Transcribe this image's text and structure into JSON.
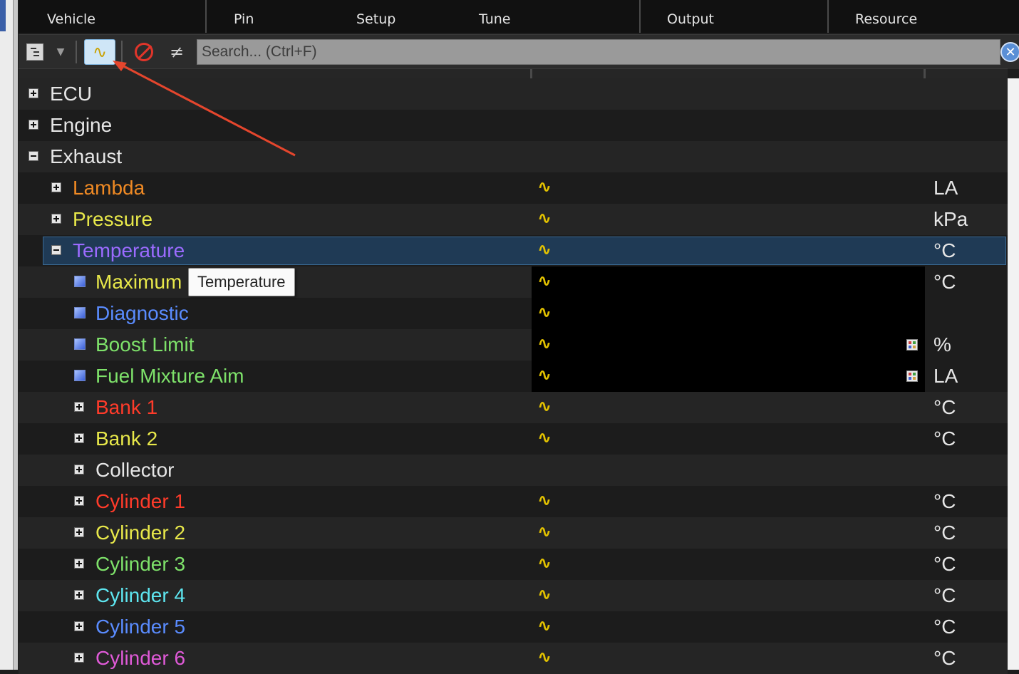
{
  "tabs": [
    "Vehicle",
    "Pin",
    "Setup",
    "Tune",
    "Output",
    "Resource"
  ],
  "toolbar": {
    "search_placeholder": "Search... (Ctrl+F)",
    "wave_glyph": "∿",
    "not_equal_glyph": "≠",
    "clear_glyph": "✕"
  },
  "tree": {
    "rows": [
      {
        "label": "ECU",
        "color": "#e6e6e6",
        "expander": "plus",
        "level": 0,
        "wave": false,
        "unit": "",
        "table_icon": false
      },
      {
        "label": "Engine",
        "color": "#e6e6e6",
        "expander": "plus",
        "level": 0,
        "wave": false,
        "unit": "",
        "table_icon": false
      },
      {
        "label": "Exhaust",
        "color": "#e6e6e6",
        "expander": "minus",
        "level": 0,
        "wave": false,
        "unit": "",
        "table_icon": false
      },
      {
        "label": "Lambda",
        "color": "#f08a24",
        "expander": "plus",
        "level": 1,
        "wave": true,
        "unit": "LA",
        "table_icon": false
      },
      {
        "label": "Pressure",
        "color": "#e8e84a",
        "expander": "plus",
        "level": 1,
        "wave": true,
        "unit": "kPa",
        "table_icon": false
      },
      {
        "label": "Temperature",
        "color": "#9b6bff",
        "expander": "minus",
        "level": 1,
        "wave": true,
        "unit": "°C",
        "table_icon": false,
        "selected": true
      },
      {
        "label": "Maximum",
        "color": "#e8e84a",
        "expander": "leaf",
        "level": 2,
        "wave": true,
        "unit": "°C",
        "table_icon": false
      },
      {
        "label": "Diagnostic",
        "color": "#5a8cff",
        "expander": "leaf",
        "level": 2,
        "wave": true,
        "unit": "",
        "table_icon": false
      },
      {
        "label": "Boost Limit",
        "color": "#7ee26a",
        "expander": "leaf",
        "level": 2,
        "wave": true,
        "unit": "%",
        "table_icon": true
      },
      {
        "label": "Fuel Mixture Aim",
        "color": "#7ee26a",
        "expander": "leaf",
        "level": 2,
        "wave": true,
        "unit": "LA",
        "table_icon": true
      },
      {
        "label": "Bank 1",
        "color": "#ff3b2a",
        "expander": "plus",
        "level": 2,
        "wave": true,
        "unit": "°C",
        "table_icon": false
      },
      {
        "label": "Bank 2",
        "color": "#e8e84a",
        "expander": "plus",
        "level": 2,
        "wave": true,
        "unit": "°C",
        "table_icon": false
      },
      {
        "label": "Collector",
        "color": "#e6e6e6",
        "expander": "plus",
        "level": 2,
        "wave": false,
        "unit": "",
        "table_icon": false
      },
      {
        "label": "Cylinder 1",
        "color": "#ff3b2a",
        "expander": "plus",
        "level": 2,
        "wave": true,
        "unit": "°C",
        "table_icon": false
      },
      {
        "label": "Cylinder 2",
        "color": "#e8e84a",
        "expander": "plus",
        "level": 2,
        "wave": true,
        "unit": "°C",
        "table_icon": false
      },
      {
        "label": "Cylinder 3",
        "color": "#7ee26a",
        "expander": "plus",
        "level": 2,
        "wave": true,
        "unit": "°C",
        "table_icon": false
      },
      {
        "label": "Cylinder 4",
        "color": "#5ee6f0",
        "expander": "plus",
        "level": 2,
        "wave": true,
        "unit": "°C",
        "table_icon": false
      },
      {
        "label": "Cylinder 5",
        "color": "#5a8cff",
        "expander": "plus",
        "level": 2,
        "wave": true,
        "unit": "°C",
        "table_icon": false
      },
      {
        "label": "Cylinder 6",
        "color": "#e05ad8",
        "expander": "plus",
        "level": 2,
        "wave": true,
        "unit": "°C",
        "table_icon": false
      }
    ]
  },
  "tooltip": {
    "text": "Temperature"
  },
  "annotation": {
    "arrow_color": "#e5462d"
  }
}
